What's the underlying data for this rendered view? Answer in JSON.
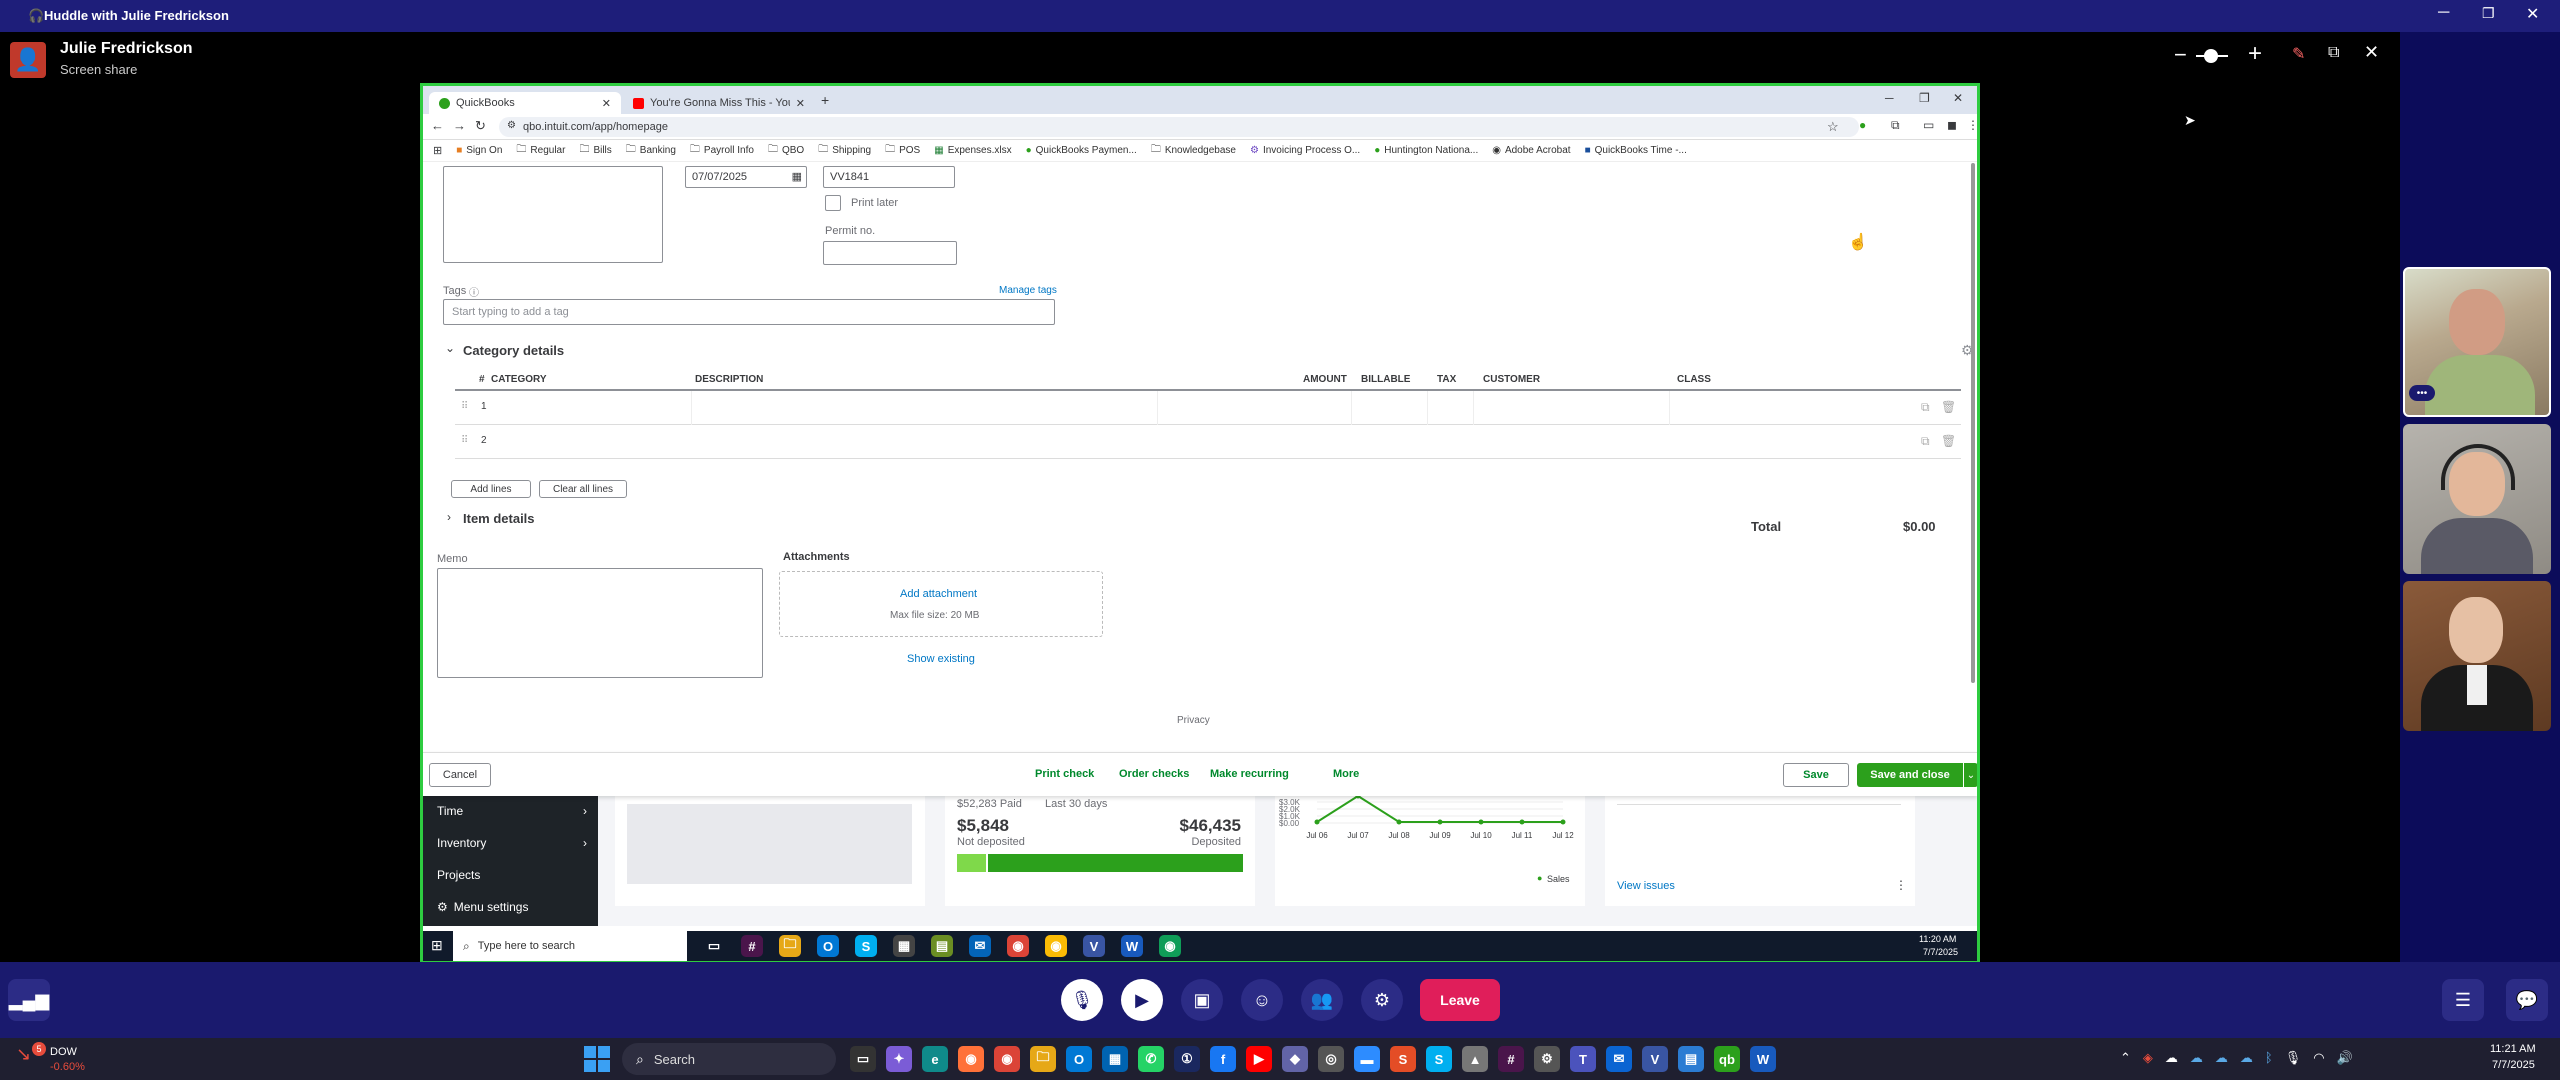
{
  "huddle": {
    "title": "Huddle with Julie Fredrickson",
    "presenter_name": "Julie Fredrickson",
    "presenter_status": "Screen share"
  },
  "browser": {
    "tabs": [
      {
        "label": "QuickBooks",
        "favicon_color": "#2ca01c"
      },
      {
        "label": "You're Gonna Miss This - YouTu",
        "favicon_color": "#ff0000"
      }
    ],
    "url": "qbo.intuit.com/app/homepage",
    "bookmarks": [
      "Sign On",
      "Regular",
      "Bills",
      "Banking",
      "Payroll Info",
      "QBO",
      "Shipping",
      "POS",
      "Expenses.xlsx",
      "QuickBooks Paymen...",
      "Knowledgebase",
      "Invoicing Process O...",
      "Huntington Nationa...",
      "Adobe Acrobat",
      "QuickBooks Time -..."
    ]
  },
  "form": {
    "date_value": "07/07/2025",
    "ref_value": "VV1841",
    "print_later_label": "Print later",
    "permit_label": "Permit no.",
    "tags_label": "Tags",
    "manage_tags": "Manage tags",
    "tags_placeholder": "Start typing to add a tag",
    "category_title": "Category details",
    "columns": {
      "num": "#",
      "category": "CATEGORY",
      "description": "DESCRIPTION",
      "amount": "AMOUNT",
      "billable": "BILLABLE",
      "tax": "TAX",
      "customer": "CUSTOMER",
      "class": "CLASS"
    },
    "rows": [
      "1",
      "2"
    ],
    "add_lines": "Add lines",
    "clear_lines": "Clear all lines",
    "item_details": "Item details",
    "total_label": "Total",
    "total_value": "$0.00",
    "memo_label": "Memo",
    "attachments_label": "Attachments",
    "add_attachment": "Add attachment",
    "max_size": "Max file size: 20 MB",
    "show_existing": "Show existing",
    "privacy": "Privacy"
  },
  "footer": {
    "cancel": "Cancel",
    "print_check": "Print check",
    "order_checks": "Order checks",
    "make_recurring": "Make recurring",
    "more": "More",
    "save": "Save",
    "save_close": "Save and close"
  },
  "qb_sidebar": [
    "Time",
    "Inventory",
    "Projects",
    "Menu settings"
  ],
  "deposits": {
    "paid": "$52,283 Paid",
    "period": "Last 30 days",
    "not_deposited_amount": "$5,848",
    "not_deposited_label": "Not deposited",
    "deposited_amount": "$46,435",
    "deposited_label": "Deposited",
    "not_deposited_fraction": 0.11
  },
  "sales_chart": {
    "y_ticks": [
      "$3.0K",
      "$2.0K",
      "$1.0K",
      "$0.00"
    ],
    "x_ticks": [
      "Jul 06",
      "Jul 07",
      "Jul 08",
      "Jul 09",
      "Jul 10",
      "Jul 11",
      "Jul 12"
    ],
    "legend": "Sales"
  },
  "chart_data": {
    "type": "line",
    "categories": [
      "Jul 06",
      "Jul 07",
      "Jul 08",
      "Jul 09",
      "Jul 10",
      "Jul 11",
      "Jul 12"
    ],
    "series": [
      {
        "name": "Sales",
        "values": [
          0,
          3500,
          0,
          0,
          0,
          0,
          0
        ]
      }
    ],
    "ylim": [
      0,
      3500
    ]
  },
  "view_issues": "View issues",
  "win_taskbar": {
    "search_placeholder": "Type here to search",
    "time": "11:20 AM",
    "date": "7/7/2025"
  },
  "controls": {
    "leave": "Leave"
  },
  "os_taskbar": {
    "stock_name": "DOW",
    "stock_change": "-0.60%",
    "search": "Search",
    "time": "11:21 AM",
    "date": "7/7/2025",
    "badge_count": "5"
  }
}
